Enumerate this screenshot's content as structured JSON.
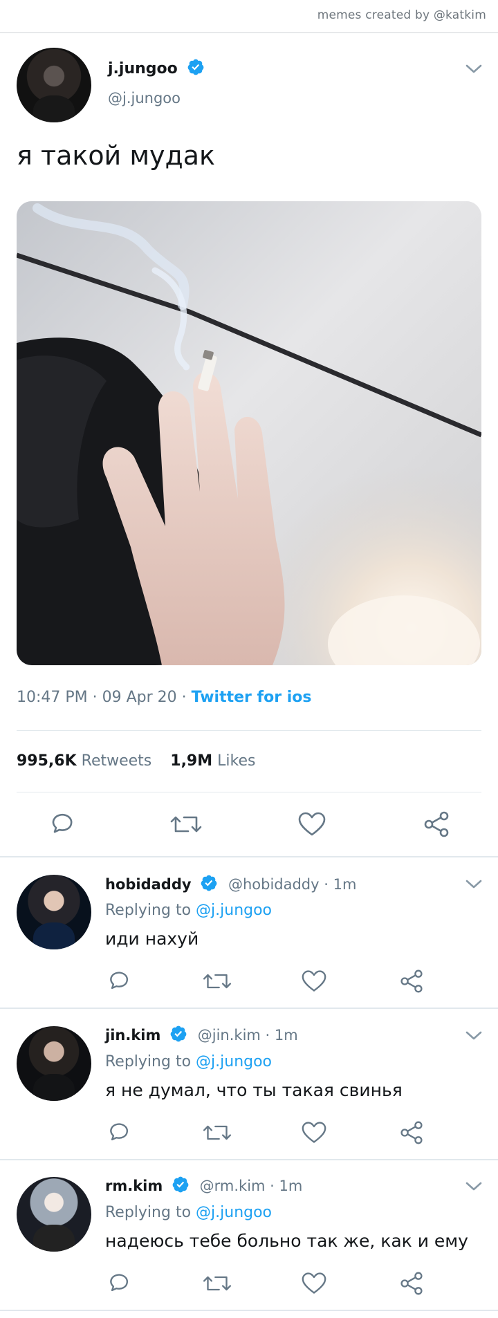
{
  "credit": "memes created by @katkim",
  "tweet": {
    "author_name": "j.jungoo",
    "author_handle": "@j.jungoo",
    "text": "я такой мудак",
    "time": "10:47 PM · 09 Apr 20 · ",
    "client": "Twitter for ios",
    "retweets_count": "995,6K",
    "retweets_label": "Retweets",
    "likes_count": "1,9M",
    "likes_label": "Likes"
  },
  "replies": [
    {
      "name": "hobidaddy",
      "handle": "@hobidaddy · 1m",
      "replying_label": "Replying to",
      "replying_to": "@j.jungoo",
      "text": "иди нахуй"
    },
    {
      "name": "jin.kim",
      "handle": "@jin.kim · 1m",
      "replying_label": "Replying to",
      "replying_to": "@j.jungoo",
      "text": "я не думал, что ты такая свинья"
    },
    {
      "name": "rm.kim",
      "handle": "@rm.kim · 1m",
      "replying_label": "Replying to",
      "replying_to": "@j.jungoo",
      "text": "надеюсь тебе больно так же, как и ему"
    }
  ],
  "colors": {
    "accent": "#1da1f2",
    "text_primary": "#14171a",
    "text_secondary": "#657786",
    "divider": "#e1e8ed"
  },
  "icons": [
    "verified-badge-icon",
    "chevron-down-icon",
    "reply-icon",
    "retweet-icon",
    "like-icon",
    "share-icon"
  ]
}
